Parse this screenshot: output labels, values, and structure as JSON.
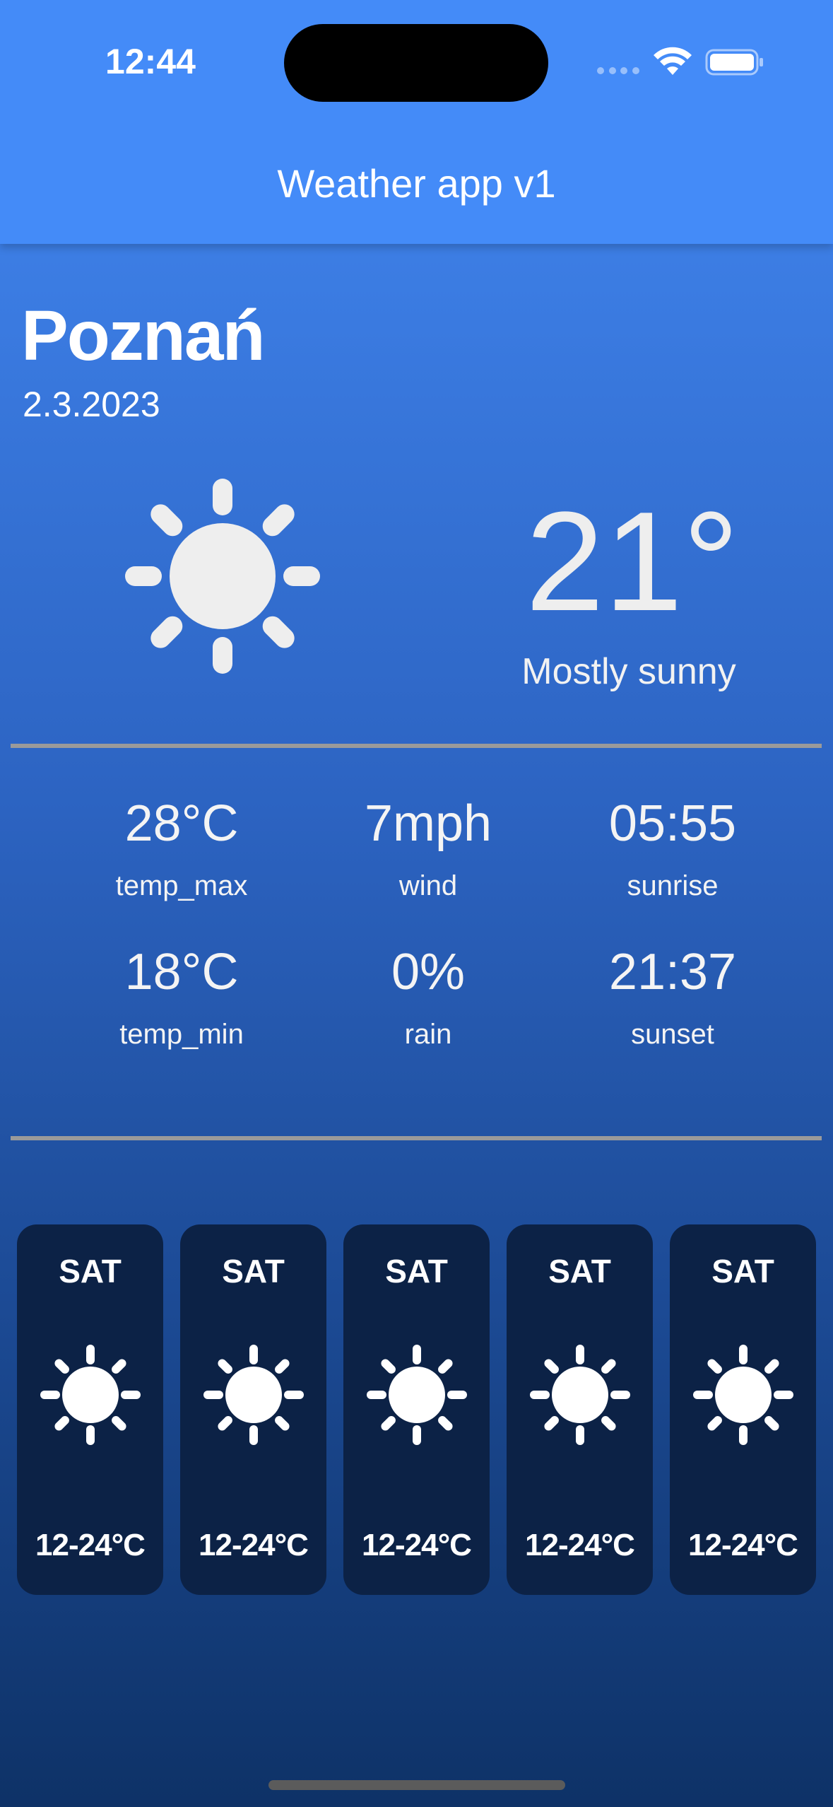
{
  "status_bar": {
    "time": "12:44"
  },
  "header": {
    "title": "Weather app v1"
  },
  "location": {
    "city": "Poznań",
    "date": "2.3.2023"
  },
  "current": {
    "temperature": "21°",
    "condition": "Mostly sunny",
    "icon": "sun-icon"
  },
  "stats": [
    {
      "value": "28°C",
      "label": "temp_max"
    },
    {
      "value": "7mph",
      "label": "wind"
    },
    {
      "value": "05:55",
      "label": "sunrise"
    },
    {
      "value": "18°C",
      "label": "temp_min"
    },
    {
      "value": "0%",
      "label": "rain"
    },
    {
      "value": "21:37",
      "label": "sunset"
    }
  ],
  "forecast": [
    {
      "day": "SAT",
      "icon": "sun-icon",
      "range": "12-24°C"
    },
    {
      "day": "SAT",
      "icon": "sun-icon",
      "range": "12-24°C"
    },
    {
      "day": "SAT",
      "icon": "sun-icon",
      "range": "12-24°C"
    },
    {
      "day": "SAT",
      "icon": "sun-icon",
      "range": "12-24°C"
    },
    {
      "day": "SAT",
      "icon": "sun-icon",
      "range": "12-24°C"
    }
  ],
  "colors": {
    "header": "#448bf8",
    "card": "#0c2246",
    "divider": "#9a9a9a",
    "icon": "#eeeeee"
  }
}
